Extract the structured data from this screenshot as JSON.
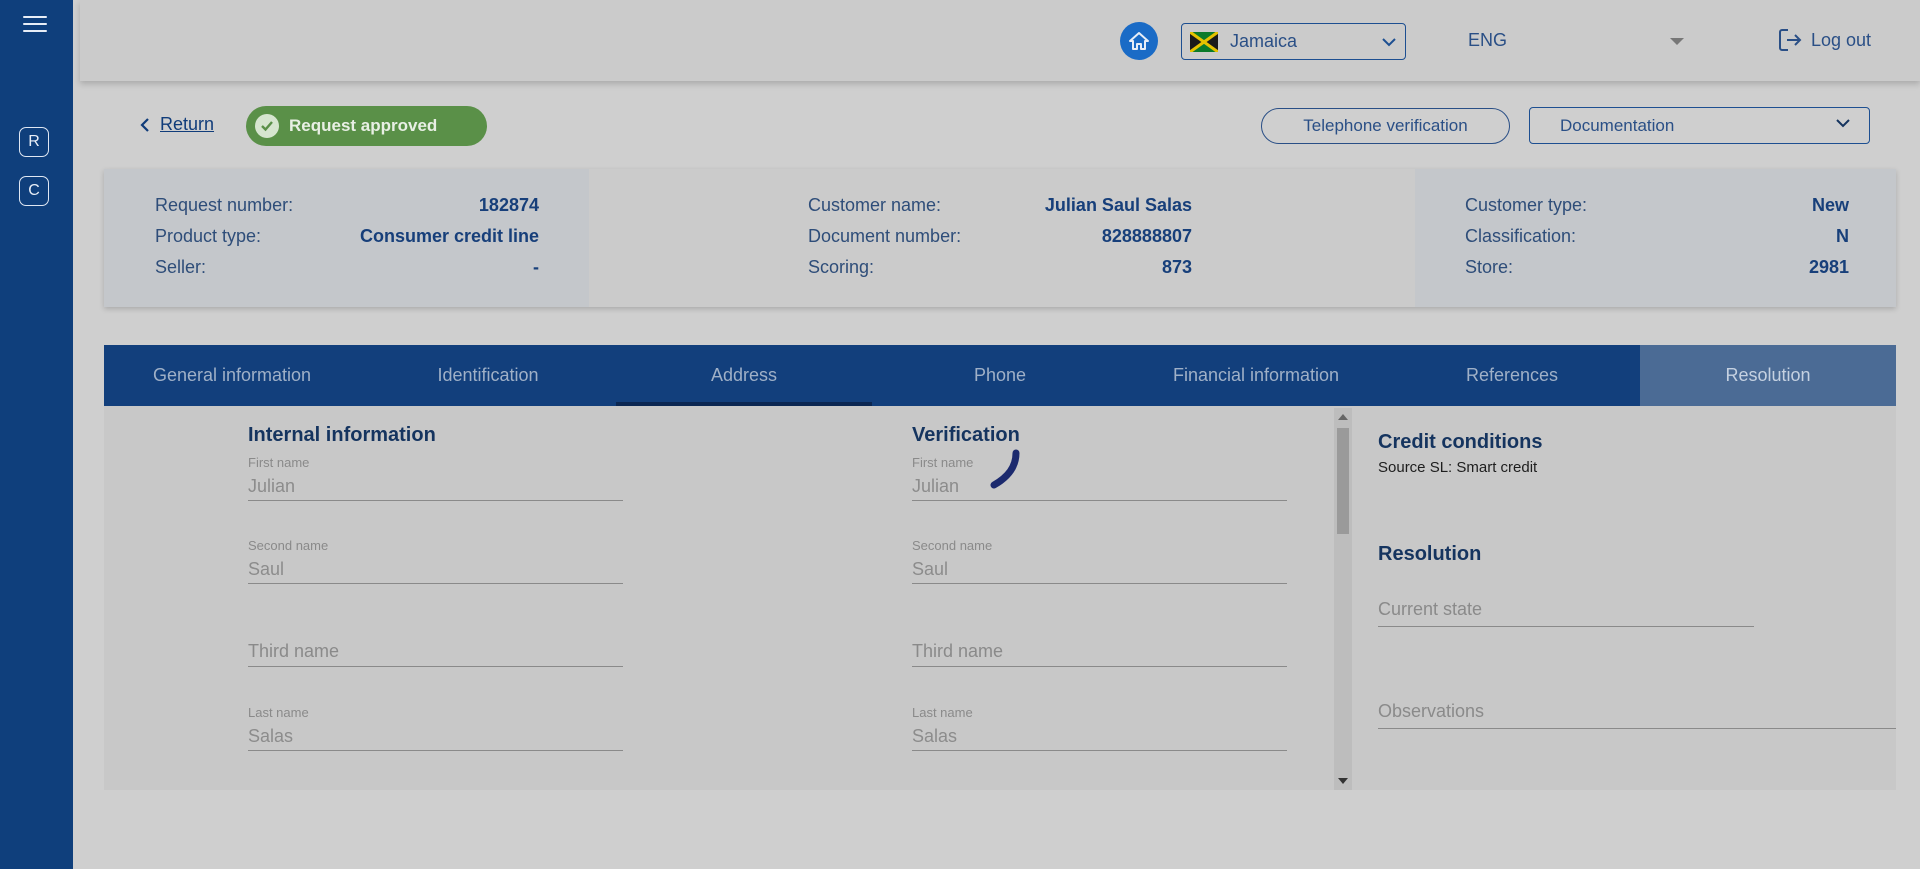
{
  "sidebar": {
    "buttons": [
      "R",
      "C"
    ]
  },
  "topbar": {
    "country": "Jamaica",
    "language": "ENG",
    "logout_label": "Log out"
  },
  "header": {
    "return_label": "Return",
    "status_badge": "Request approved",
    "telephone_verification_label": "Telephone verification",
    "documentation_label": "Documentation"
  },
  "info": {
    "col1": [
      {
        "label": "Request number:",
        "value": "182874"
      },
      {
        "label": "Product type:",
        "value": "Consumer credit line"
      },
      {
        "label": "Seller:",
        "value": "-"
      }
    ],
    "col2": [
      {
        "label": "Customer name:",
        "value": "Julian Saul Salas"
      },
      {
        "label": "Document number:",
        "value": "828888807"
      },
      {
        "label": "Scoring:",
        "value": "873"
      }
    ],
    "col3": [
      {
        "label": "Customer type:",
        "value": "New"
      },
      {
        "label": "Classification:",
        "value": "N"
      },
      {
        "label": "Store:",
        "value": "2981"
      }
    ]
  },
  "tabs": [
    "General information",
    "Identification",
    "Address",
    "Phone",
    "Financial information",
    "References",
    "Resolution"
  ],
  "internal": {
    "title": "Internal information",
    "fields": [
      {
        "label": "First name",
        "value": "Julian"
      },
      {
        "label": "Second name",
        "value": "Saul"
      },
      {
        "label": "",
        "placeholder": "Third name"
      },
      {
        "label": "Last name",
        "value": "Salas"
      }
    ]
  },
  "verification": {
    "title": "Verification",
    "fields": [
      {
        "label": "First name",
        "value": "Julian"
      },
      {
        "label": "Second name",
        "value": "Saul"
      },
      {
        "label": "",
        "placeholder": "Third name"
      },
      {
        "label": "Last name",
        "value": "Salas"
      }
    ]
  },
  "credit": {
    "title": "Credit conditions",
    "source": "Source SL: Smart credit"
  },
  "resolution": {
    "title": "Resolution",
    "current_state_placeholder": "Current state",
    "observations_placeholder": "Observations"
  },
  "colors": {
    "primary": "#123f7c",
    "accent": "#1a6bc6",
    "success": "#5a9048"
  },
  "icons": [
    "menu-icon",
    "home-icon",
    "jamaica-flag-icon",
    "chevron-down-icon",
    "logout-icon",
    "chevron-left-icon",
    "check-icon",
    "loading-spinner-icon"
  ]
}
